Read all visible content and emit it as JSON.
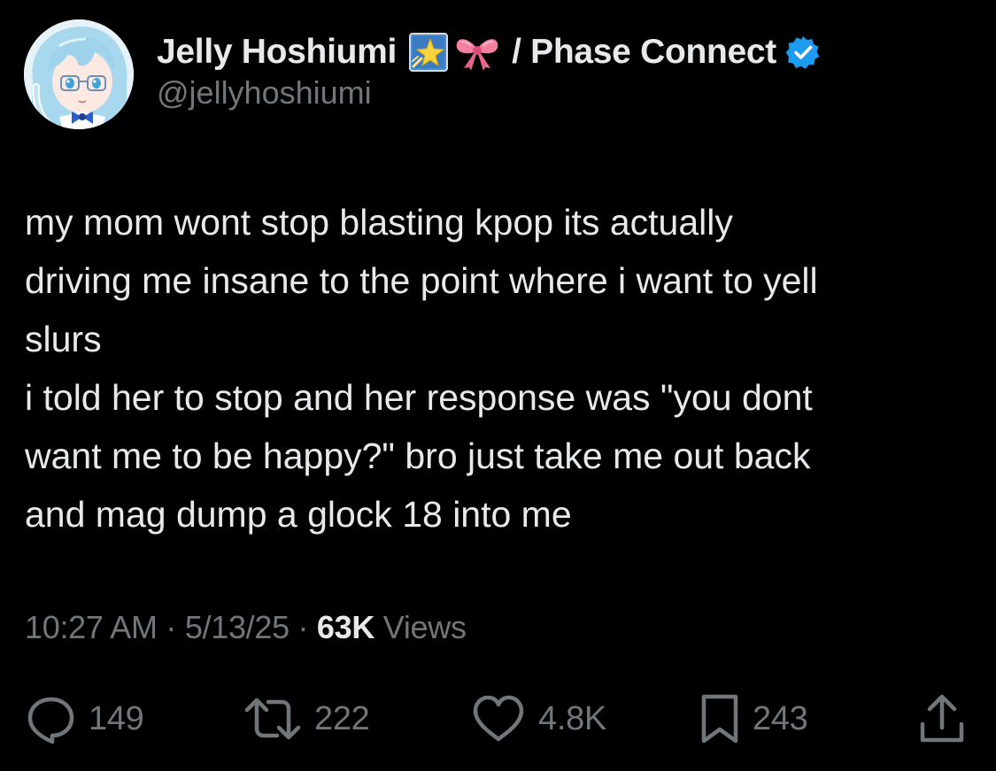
{
  "author": {
    "display_name": "Jelly Hoshiumi",
    "affiliation": "/ Phase Connect",
    "handle": "@jellyhoshiumi",
    "badges": [
      "star-emoji-icon",
      "ribbon-bow-emoji-icon",
      "verified-badge-icon"
    ],
    "verified_color": "#1d9bf0"
  },
  "tweet": {
    "lines": [
      "my mom wont stop blasting kpop its actually",
      "driving me insane to the point where i want to yell",
      "slurs",
      "i told her to stop and her response was \"you dont",
      "want me to be happy?\" bro just take me out back",
      "and mag dump a glock 18 into me"
    ]
  },
  "meta": {
    "time": "10:27 AM",
    "sep1": " · ",
    "date": "5/13/25",
    "sep2": " · ",
    "views_count": "63K",
    "views_label": " Views"
  },
  "actions": {
    "replies": "149",
    "retweets": "222",
    "likes": "4.8K",
    "bookmarks": "243"
  },
  "colors": {
    "background": "#000000",
    "primary_text": "#e7e9ea",
    "secondary_text": "#71767b"
  }
}
